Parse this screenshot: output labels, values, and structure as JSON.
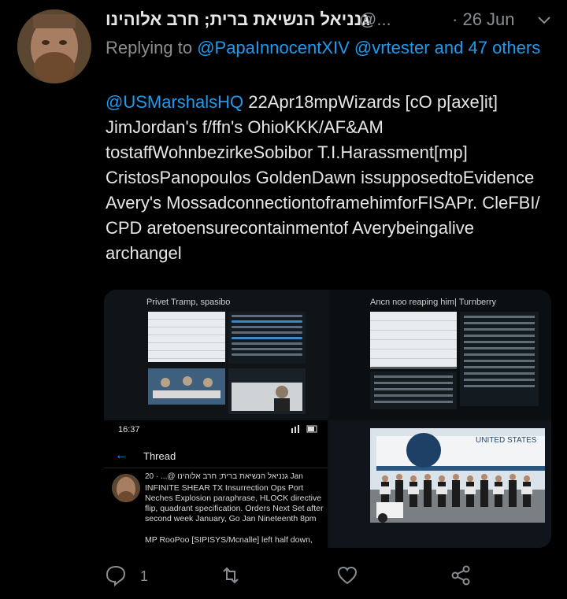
{
  "tweet": {
    "name": "גנניאל הנשיאת ברית; חרב אלוהינו",
    "handle": "@...",
    "separator": "·",
    "date": "26 Jun",
    "reply_prefix": "Replying to ",
    "reply_links": "@PapaInnocentXIV @vrtester and 47 others",
    "mention": "@USMarshalsHQ",
    "text": " 22Apr18mpWizards [cO p[axe]it] JimJordan's f/ffn's OhioKKK/AF&AM tostaffWohnbezirkeSobibor T.I.Harassment[mp] CristosPanopoulos GoldenDawn issupposedtoEvidence Avery's MossadconnectiontoframehimforFISAPr. CleFBI/ CPD aretoensurecontainmentof Averybeingalive archangel"
  },
  "media": {
    "img1_title": "Privet Tramp, spasibo",
    "img2_title": "Ancn noo reaping him| Turnberry",
    "img3": {
      "time": "16:37",
      "back": "←",
      "title": "Thread",
      "author": "גנניאל הנשיאת ברית; חרב אלוהינו @... · 20 Jan",
      "body": "INFINITE SHEAR TX Insurrection Ops Port Neches Explosion paraphrase, HLOCK directive flip, quadrant specification. Orders Next Set after second week January, Go Jan Nineteenth 8pm",
      "body2": "MP RooPoo [SIPISYS/Mcnalle] left half down, use"
    },
    "img4_plane_text": "UNITED STATES"
  },
  "actions": {
    "reply_count": "1",
    "retweet_count": "",
    "like_count": ""
  }
}
